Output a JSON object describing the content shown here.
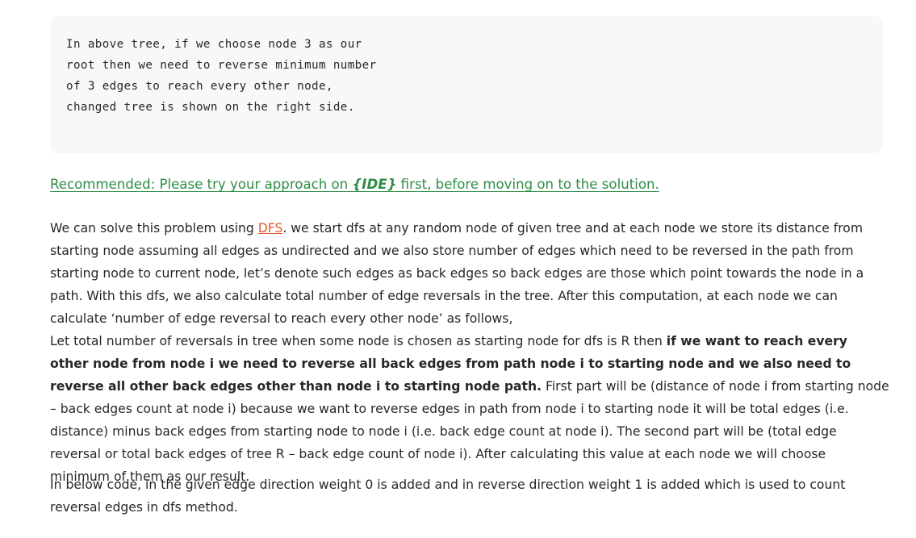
{
  "code_block": {
    "lines": [
      "In above tree, if we choose node 3 as our",
      "root then we need to reverse minimum number",
      "of 3 edges to reach every other node,",
      "changed tree is shown on the right side."
    ]
  },
  "recommended": {
    "prefix": "Recommended: Please try your approach on ",
    "ide": "{IDE}",
    "suffix": " first, before moving on to the solution."
  },
  "paragraph1": {
    "s1": "We can solve this problem using ",
    "dfs_link": "DFS",
    "s2": ". we start dfs at any random node of given tree and at each node we store its distance from starting node assuming all edges as undirected and we also store number of edges which need to be reversed in the path from starting node to current node, let’s denote such edges as back edges so back edges are those which point towards the node in a path. With this dfs, we also calculate total number of edge reversals in the tree. After this computation, at each node we can calculate ‘number of edge reversal to reach every other node’ as follows,",
    "s3": "Let total number of reversals in tree when some node is chosen as starting node for dfs is R then ",
    "bold": "if we want to reach every other node from node i we need to reverse all back edges from path node i to starting node and we also need to reverse all other back edges other than node i to starting node path.",
    "s4": " First part will be (distance of node i from starting node – back edges count at node i) because we want to reverse edges in path from node i to starting node it will be total edges (i.e. distance) minus back edges from starting node to node i (i.e. back edge count at node i). The second part will be (total edge reversal or total back edges of tree R – back edge count of node i). After calculating this value at each node we will choose minimum of them as our result."
  },
  "paragraph2": {
    "text": "In below code, in the given edge direction weight 0 is added and in reverse direction weight 1 is added which is used to count reversal edges in dfs method."
  },
  "colors": {
    "recommend_green": "#2f8d46",
    "link_orange": "#e45c2b",
    "code_bg": "#f8f8f8"
  }
}
